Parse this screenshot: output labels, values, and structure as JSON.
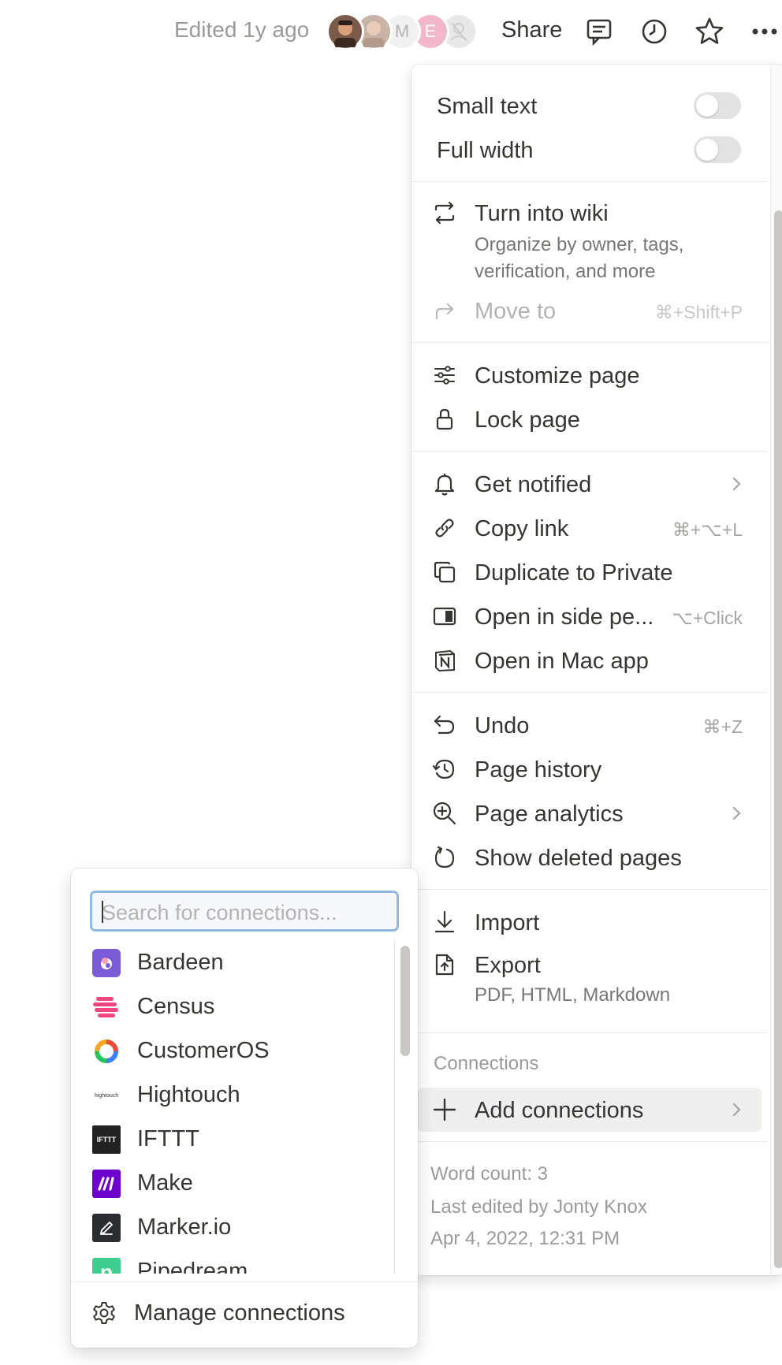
{
  "topbar": {
    "edited": "Edited 1y ago",
    "avatars": [
      {
        "initial": "",
        "color": "#7a5a48"
      },
      {
        "initial": "",
        "color": "#c9b3a6"
      },
      {
        "initial": "M",
        "color": "#f1f1ef"
      },
      {
        "initial": "E",
        "color": "#f2b7c9"
      },
      {
        "initial": "",
        "color": "#e8e8e6"
      }
    ],
    "share": "Share",
    "icons": [
      "comment-icon",
      "clock-icon",
      "star-icon",
      "more-icon"
    ]
  },
  "menu": {
    "toggles": [
      {
        "label": "Small text",
        "on": false
      },
      {
        "label": "Full width",
        "on": false
      }
    ],
    "wiki": {
      "label": "Turn into wiki",
      "desc_line1": "Organize by owner, tags,",
      "desc_line2": "verification, and more"
    },
    "move_to": {
      "label": "Move to",
      "shortcut": "⌘+Shift+P"
    },
    "customize": "Customize page",
    "lock": "Lock page",
    "get_notified": "Get notified",
    "copy_link": {
      "label": "Copy link",
      "shortcut": "⌘+⌥+L"
    },
    "duplicate": "Duplicate to Private",
    "side_peek": {
      "label": "Open in side pe...",
      "shortcut": "⌥+Click"
    },
    "mac_app": "Open in Mac app",
    "undo": {
      "label": "Undo",
      "shortcut": "⌘+Z"
    },
    "page_history": "Page history",
    "page_analytics": "Page analytics",
    "deleted_pages": "Show deleted pages",
    "import": "Import",
    "export": {
      "label": "Export",
      "desc": "PDF, HTML, Markdown"
    },
    "connections_heading": "Connections",
    "add_connections": "Add connections",
    "word_count": "Word count: 3",
    "last_edited_by": "Last edited by Jonty Knox",
    "last_edited_date": "Apr 4, 2022, 12:31 PM"
  },
  "connections": {
    "search_placeholder": "Search for connections...",
    "items": [
      {
        "label": "Bardeen",
        "logo_text": "",
        "color": "#7b5cd6"
      },
      {
        "label": "Census",
        "logo_text": "",
        "color": "#f0457e"
      },
      {
        "label": "CustomerOS",
        "logo_text": "",
        "color": "#f6a623"
      },
      {
        "label": "Hightouch",
        "logo_text": "hightouch",
        "color": "#ffffff"
      },
      {
        "label": "IFTTT",
        "logo_text": "IFTTT",
        "color": "#222222"
      },
      {
        "label": "Make",
        "logo_text": "M",
        "color": "#6d00cc"
      },
      {
        "label": "Marker.io",
        "logo_text": "",
        "color": "#2b2d33"
      },
      {
        "label": "Pipedream",
        "logo_text": "p",
        "color": "#3ecf8e"
      }
    ],
    "manage": "Manage connections"
  }
}
